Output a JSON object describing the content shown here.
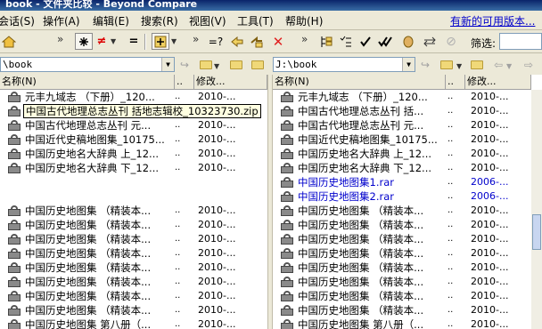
{
  "window": {
    "title": "book - 文件夹比较 - Beyond Compare"
  },
  "menu": {
    "items": [
      "会话(S)",
      "操作(A)",
      "编辑(E)",
      "搜索(R)",
      "视图(V)",
      "工具(T)",
      "帮助(H)"
    ],
    "update_link": "有新的可用版本..."
  },
  "toolbar": {
    "filter_label": "筛选:"
  },
  "left": {
    "path": "\\book",
    "headers": {
      "name": "名称(N)",
      "dots": "..",
      "date": "修改..."
    },
    "tooltip": "中国古代地理总志丛刊  括地志辑校_10323730.zip",
    "rows": [
      {
        "name": "元丰九域志 （下册）_120...",
        "dots": "..",
        "date": "2010-..."
      },
      {
        "name": "中国古代地理总志丛刊",
        "dots": "..",
        "date": "2010-..."
      },
      {
        "name": "中国古代地理总志丛刊  元...",
        "dots": "..",
        "date": "2010-..."
      },
      {
        "name": "中国近代史稿地图集_10175...",
        "dots": "..",
        "date": "2010-..."
      },
      {
        "name": "中国历史地名大辞典 上_12...",
        "dots": "..",
        "date": "2010-..."
      },
      {
        "name": "中国历史地名大辞典 下_12...",
        "dots": "..",
        "date": "2010-..."
      },
      {
        "name": "",
        "dots": "",
        "date": ""
      },
      {
        "name": "",
        "dots": "",
        "date": ""
      },
      {
        "name": "中国历史地图集  （精装本...",
        "dots": "..",
        "date": "2010-..."
      },
      {
        "name": "中国历史地图集  （精装本...",
        "dots": "..",
        "date": "2010-..."
      },
      {
        "name": "中国历史地图集  （精装本...",
        "dots": "..",
        "date": "2010-..."
      },
      {
        "name": "中国历史地图集  （精装本...",
        "dots": "..",
        "date": "2010-..."
      },
      {
        "name": "中国历史地图集  （精装本...",
        "dots": "..",
        "date": "2010-..."
      },
      {
        "name": "中国历史地图集  （精装本...",
        "dots": "..",
        "date": "2010-..."
      },
      {
        "name": "中国历史地图集  （精装本...",
        "dots": "..",
        "date": "2010-..."
      },
      {
        "name": "中国历史地图集  （精装本...",
        "dots": "..",
        "date": "2010-..."
      },
      {
        "name": "中国历史地图集  第八册（...",
        "dots": "..",
        "date": "2010-..."
      }
    ]
  },
  "right": {
    "path": "J:\\book",
    "headers": {
      "name": "名称(N)",
      "dots": "..",
      "date": "修改..."
    },
    "rows": [
      {
        "name": "元丰九域志 （下册）_120...",
        "dots": "..",
        "date": "2010-...",
        "blue": false
      },
      {
        "name": "中国古代地理总志丛刊  括...",
        "dots": "..",
        "date": "2010-...",
        "blue": false
      },
      {
        "name": "中国古代地理总志丛刊  元...",
        "dots": "..",
        "date": "2010-...",
        "blue": false
      },
      {
        "name": "中国近代史稿地图集_10175...",
        "dots": "..",
        "date": "2010-...",
        "blue": false
      },
      {
        "name": "中国历史地名大辞典 上_12...",
        "dots": "..",
        "date": "2010-...",
        "blue": false
      },
      {
        "name": "中国历史地名大辞典 下_12...",
        "dots": "..",
        "date": "2010-...",
        "blue": false
      },
      {
        "name": "中国历史地图集1.rar",
        "dots": "..",
        "date": "2006-...",
        "blue": true
      },
      {
        "name": "中国历史地图集2.rar",
        "dots": "..",
        "date": "2006-...",
        "blue": true
      },
      {
        "name": "中国历史地图集  （精装本...",
        "dots": "..",
        "date": "2010-...",
        "blue": false
      },
      {
        "name": "中国历史地图集  （精装本...",
        "dots": "..",
        "date": "2010-...",
        "blue": false
      },
      {
        "name": "中国历史地图集  （精装本...",
        "dots": "..",
        "date": "2010-...",
        "blue": false
      },
      {
        "name": "中国历史地图集  （精装本...",
        "dots": "..",
        "date": "2010-...",
        "blue": false
      },
      {
        "name": "中国历史地图集  （精装本...",
        "dots": "..",
        "date": "2010-...",
        "blue": false
      },
      {
        "name": "中国历史地图集  （精装本...",
        "dots": "..",
        "date": "2010-...",
        "blue": false
      },
      {
        "name": "中国历史地图集  （精装本...",
        "dots": "..",
        "date": "2010-...",
        "blue": false
      },
      {
        "name": "中国历史地图集  （精装本...",
        "dots": "..",
        "date": "2010-...",
        "blue": false
      },
      {
        "name": "中国历史地图集  第八册（...",
        "dots": "..",
        "date": "2010-...",
        "blue": false
      }
    ]
  }
}
